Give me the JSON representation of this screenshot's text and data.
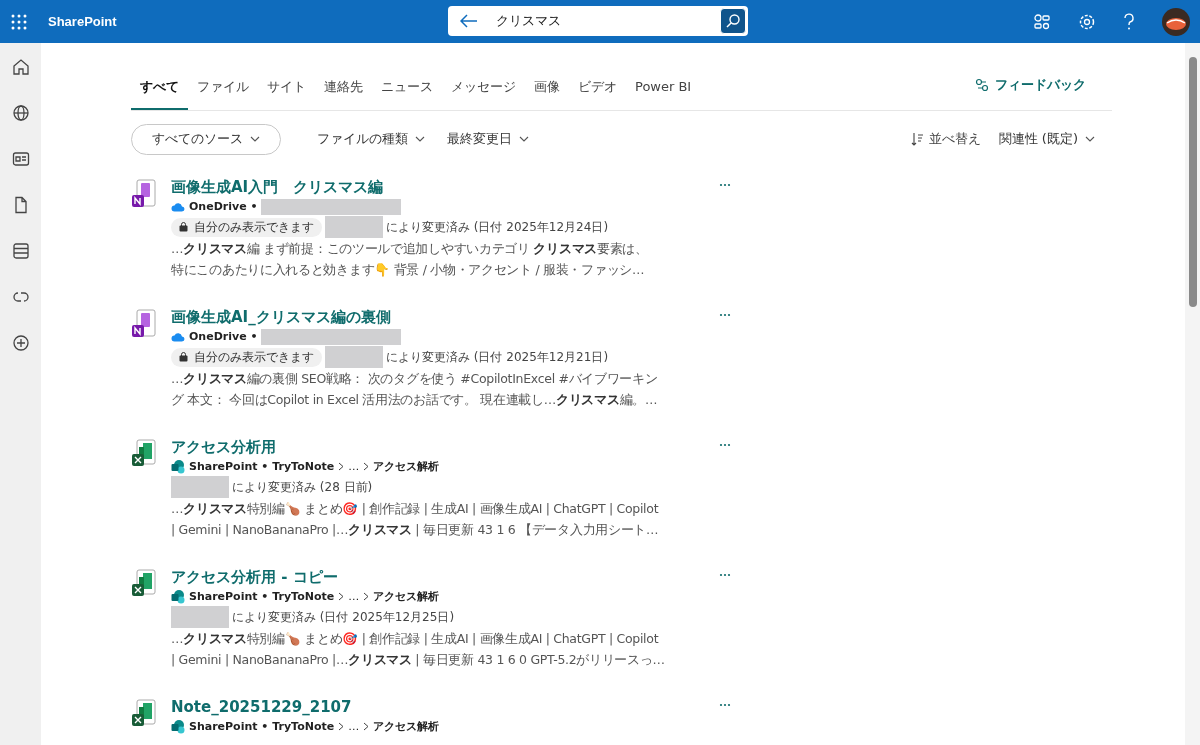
{
  "app": {
    "name": "SharePoint"
  },
  "search": {
    "value": "クリスマス"
  },
  "tabs": [
    {
      "label": "すべて",
      "selected": true
    },
    {
      "label": "ファイル",
      "selected": false
    },
    {
      "label": "サイト",
      "selected": false
    },
    {
      "label": "連絡先",
      "selected": false
    },
    {
      "label": "ニュース",
      "selected": false
    },
    {
      "label": "メッセージ",
      "selected": false
    },
    {
      "label": "画像",
      "selected": false
    },
    {
      "label": "ビデオ",
      "selected": false
    },
    {
      "label": "Power BI",
      "selected": false
    }
  ],
  "feedback": "フィードバック",
  "filters": [
    {
      "label": "すべてのソース",
      "kind": "pill"
    },
    {
      "label": "ファイルの種類",
      "kind": "plain"
    },
    {
      "label": "最終変更日",
      "kind": "plain"
    }
  ],
  "sort": {
    "label": "並べ替え",
    "value": "関連性 (既定)"
  },
  "results": [
    {
      "kind": "onenote",
      "title": "画像生成AI入門　クリスマス編",
      "source": "OneDrive •",
      "privacy": "自分のみ表示できます",
      "modified": "により変更済み (日付 2025年12月24日)",
      "snippet": [
        "…**クリスマス**編 まず前提：このツールで追加しやすいカテゴリ **クリスマス**要素は、",
        "特にこのあたりに入れると効きます👇 背景 / 小物・アクセント / 服装・ファッシ…"
      ]
    },
    {
      "kind": "onenote",
      "title": "画像生成AI_クリスマス編の裏側",
      "source": "OneDrive •",
      "privacy": "自分のみ表示できます",
      "modified": "により変更済み (日付 2025年12月21日)",
      "snippet": [
        "…**クリスマス**編の裏側 SEO戦略： 次のタグを使う #CopilotInExcel #バイブワーキン",
        "グ 本文： 今回はCopilot in Excel 活用法のお話です。 現在連載し…**クリスマス**編。…"
      ]
    },
    {
      "kind": "excel",
      "title": "アクセス分析用",
      "source": "SharePoint • TryToNote",
      "path": [
        "…",
        "アクセス解析"
      ],
      "modified": "により変更済み (28 日前)",
      "snippet": [
        "…**クリスマス**特別編🍗 まとめ🎯 | 創作記録 | 生成AI | 画像生成AI | ChatGPT | Copilot",
        "| Gemini | NanoBananaPro |…**クリスマス** | 毎日更新 43 1 6 【データ入力用シート…"
      ]
    },
    {
      "kind": "excel",
      "title": "アクセス分析用 - コピー",
      "source": "SharePoint • TryToNote",
      "path": [
        "…",
        "アクセス解析"
      ],
      "modified": "により変更済み (日付 2025年12月25日)",
      "snippet": [
        "…**クリスマス**特別編🍗 まとめ🎯 | 創作記録 | 生成AI | 画像生成AI | ChatGPT | Copilot",
        "| Gemini | NanoBananaPro |…**クリスマス** | 毎日更新 43 1 6 0 GPT-5.2がリリースっ…"
      ]
    },
    {
      "kind": "excel",
      "title": "Note_20251229_2107",
      "source": "SharePoint • TryToNote",
      "path": [
        "…",
        "アクセス解析"
      ]
    }
  ]
}
